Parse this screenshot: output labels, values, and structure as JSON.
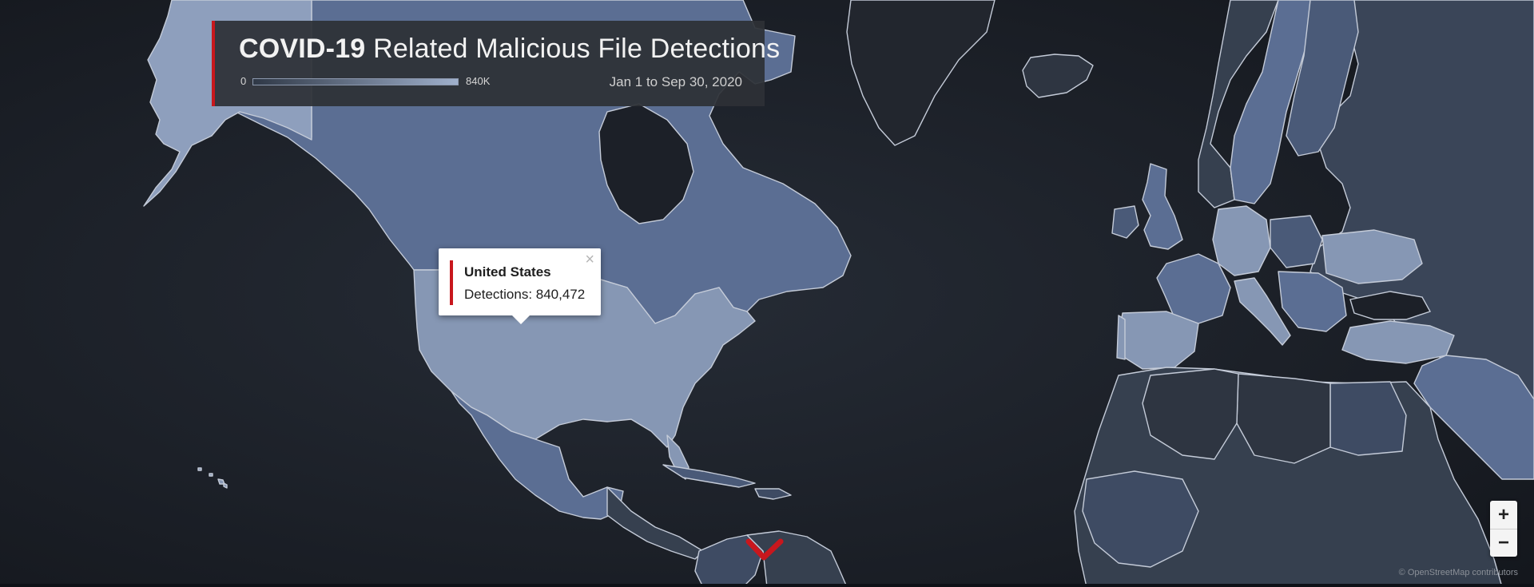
{
  "header": {
    "title_strong": "COVID-19",
    "title_rest": " Related Malicious File Detections",
    "legend_min": "0",
    "legend_max": "840K",
    "date_range": "Jan 1 to Sep 30, 2020"
  },
  "popup": {
    "country": "United States",
    "detections_label": "Detections: 840,472",
    "close_symbol": "×"
  },
  "zoom": {
    "in_label": "+",
    "out_label": "−"
  },
  "attribution": "© OpenStreetMap contributors",
  "colors": {
    "accent": "#c8171d",
    "ocean": "#1b1f27",
    "scale_low": "#2f3846",
    "scale_high": "#9fb0cc"
  }
}
